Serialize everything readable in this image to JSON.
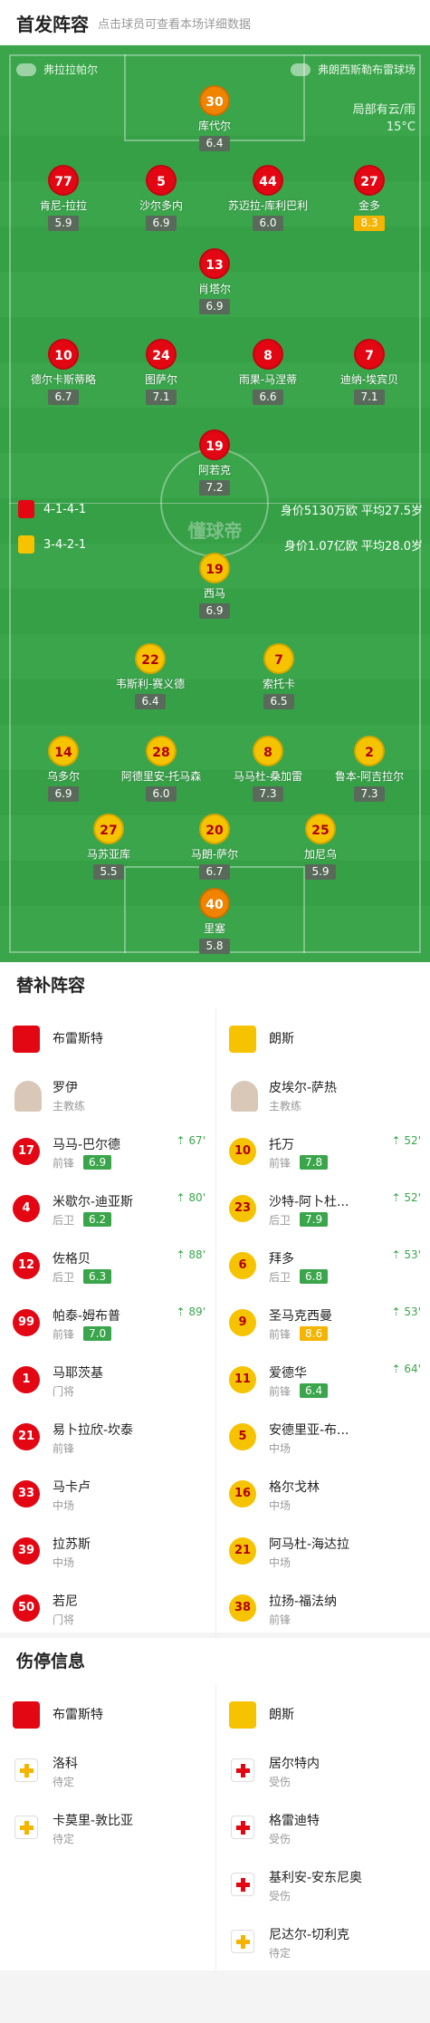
{
  "header": {
    "title": "首发阵容",
    "subtitle": "点击球员可查看本场详细数据"
  },
  "pitch": {
    "home_team": "弗拉拉帕尔",
    "away_team": "弗朗西斯勒布雷球场",
    "weather_line1": "局部有云/雨",
    "weather_line2": "15°C",
    "watermark": "懂球帝",
    "home_formation": "4-1-4-1",
    "home_value": "身价5130万欧  平均27.5岁",
    "away_formation": "3-4-2-1",
    "away_value": "身价1.07亿欧  平均28.0岁",
    "home_players": [
      {
        "num": "30",
        "name": "库代尔",
        "rating": "6.4",
        "color": "orange",
        "card": true
      },
      {
        "num": "77",
        "name": "肯尼-拉拉",
        "rating": "5.9",
        "color": "red",
        "card": true
      },
      {
        "num": "5",
        "name": "沙尔多内",
        "rating": "6.9",
        "color": "red",
        "cap": "C"
      },
      {
        "num": "44",
        "name": "苏迈拉-库利巴利",
        "rating": "6.0",
        "color": "red"
      },
      {
        "num": "27",
        "name": "金多",
        "rating": "8.3",
        "color": "red",
        "gold": true,
        "mins": "88'",
        "sub": true,
        "ball": true
      },
      {
        "num": "13",
        "name": "肖塔尔",
        "rating": "6.9",
        "color": "red",
        "sub": true
      },
      {
        "num": "10",
        "name": "德尔卡斯蒂略",
        "rating": "6.7",
        "color": "red",
        "mins": "89'",
        "sub": true
      },
      {
        "num": "24",
        "name": "图萨尔",
        "rating": "7.1",
        "color": "red",
        "mins": "80'",
        "sub": true,
        "ball": true
      },
      {
        "num": "8",
        "name": "雨果-马涅蒂",
        "rating": "6.6",
        "color": "red"
      },
      {
        "num": "7",
        "name": "迪纳-埃宾贝",
        "rating": "7.1",
        "color": "red",
        "mins": "67'",
        "sub": true,
        "card": true,
        "ball": true
      },
      {
        "num": "19",
        "name": "阿若克",
        "rating": "7.2",
        "color": "red",
        "sub": true
      }
    ],
    "away_players": [
      {
        "num": "19",
        "name": "西马",
        "rating": "6.9",
        "color": "yellow",
        "mins": "64'",
        "sub": true
      },
      {
        "num": "22",
        "name": "韦斯利-赛义德",
        "rating": "6.4",
        "color": "yellow",
        "mins": "53'",
        "sub": true
      },
      {
        "num": "7",
        "name": "索托卡",
        "rating": "6.5",
        "color": "yellow",
        "mins": "52'",
        "sub": true,
        "cap": "C"
      },
      {
        "num": "14",
        "name": "乌多尔",
        "rating": "6.9",
        "color": "yellow"
      },
      {
        "num": "28",
        "name": "阿德里安-托马森",
        "rating": "6.0",
        "color": "yellow",
        "card": true
      },
      {
        "num": "8",
        "name": "马马杜-桑加雷",
        "rating": "7.3",
        "color": "yellow",
        "card": true,
        "sub": true
      },
      {
        "num": "2",
        "name": "鲁本-阿吉拉尔",
        "rating": "7.3",
        "color": "yellow",
        "mins": "52'",
        "sub": true
      },
      {
        "num": "27",
        "name": "马苏亚库",
        "rating": "5.5",
        "color": "yellow",
        "mins": "53'",
        "sub": true
      },
      {
        "num": "20",
        "name": "马朗-萨尔",
        "rating": "6.7",
        "color": "yellow"
      },
      {
        "num": "25",
        "name": "加尼乌",
        "rating": "5.9",
        "color": "yellow"
      },
      {
        "num": "40",
        "name": "里塞",
        "rating": "5.8",
        "color": "orange"
      }
    ]
  },
  "subs": {
    "title": "替补阵容",
    "home": {
      "team": "布雷斯特",
      "coach": "罗伊",
      "coach_role": "主教练",
      "players": [
        {
          "num": "17",
          "name": "马马-巴尔德",
          "pos": "前锋",
          "rating": "6.9",
          "evt": "67'"
        },
        {
          "num": "4",
          "name": "米歇尔-迪亚斯",
          "pos": "后卫",
          "rating": "6.2",
          "evt": "80'"
        },
        {
          "num": "12",
          "name": "佐格贝",
          "pos": "后卫",
          "rating": "6.3",
          "evt": "88'"
        },
        {
          "num": "99",
          "name": "帕泰-姆布普",
          "pos": "前锋",
          "rating": "7.0",
          "evt": "89'"
        },
        {
          "num": "1",
          "name": "马耶茨基",
          "pos": "门将"
        },
        {
          "num": "21",
          "name": "易卜拉欣-坎泰",
          "pos": "前锋"
        },
        {
          "num": "33",
          "name": "马卡卢",
          "pos": "中场"
        },
        {
          "num": "39",
          "name": "拉苏斯",
          "pos": "中场"
        },
        {
          "num": "50",
          "name": "若尼",
          "pos": "门将"
        }
      ]
    },
    "away": {
      "team": "朗斯",
      "coach": "皮埃尔-萨热",
      "coach_role": "主教练",
      "players": [
        {
          "num": "10",
          "name": "托万",
          "pos": "前锋",
          "rating": "7.8",
          "evt": "52'"
        },
        {
          "num": "23",
          "name": "沙特-阿卜杜...",
          "pos": "后卫",
          "rating": "7.9",
          "evt": "52'"
        },
        {
          "num": "6",
          "name": "拜多",
          "pos": "后卫",
          "rating": "6.8",
          "evt": "53'"
        },
        {
          "num": "9",
          "name": "圣马克西曼",
          "pos": "前锋",
          "rating": "8.6",
          "gold": true,
          "evt": "53'"
        },
        {
          "num": "11",
          "name": "爱德华",
          "pos": "前锋",
          "rating": "6.4",
          "evt": "64'"
        },
        {
          "num": "5",
          "name": "安德里亚-布...",
          "pos": "中场"
        },
        {
          "num": "16",
          "name": "格尔戈林",
          "pos": "中场"
        },
        {
          "num": "21",
          "name": "阿马杜-海达拉",
          "pos": "中场"
        },
        {
          "num": "38",
          "name": "拉扬-福法纳",
          "pos": "前锋"
        }
      ]
    }
  },
  "injury": {
    "title": "伤停信息",
    "home": {
      "team": "布雷斯特",
      "players": [
        {
          "name": "洛科",
          "status": "待定",
          "type": "yellow"
        },
        {
          "name": "卡莫里-敦比亚",
          "status": "待定",
          "type": "yellow"
        }
      ]
    },
    "away": {
      "team": "朗斯",
      "players": [
        {
          "name": "居尔特内",
          "status": "受伤",
          "type": "red"
        },
        {
          "name": "格雷迪特",
          "status": "受伤",
          "type": "red"
        },
        {
          "name": "基利安-安东尼奥",
          "status": "受伤",
          "type": "red"
        },
        {
          "name": "尼达尔-切利克",
          "status": "待定",
          "type": "yellow"
        }
      ]
    }
  },
  "colors": {
    "pitch": "#3aa54b",
    "home": "#e30613",
    "away": "#f6c300",
    "rating_gold": "#f4b400"
  }
}
